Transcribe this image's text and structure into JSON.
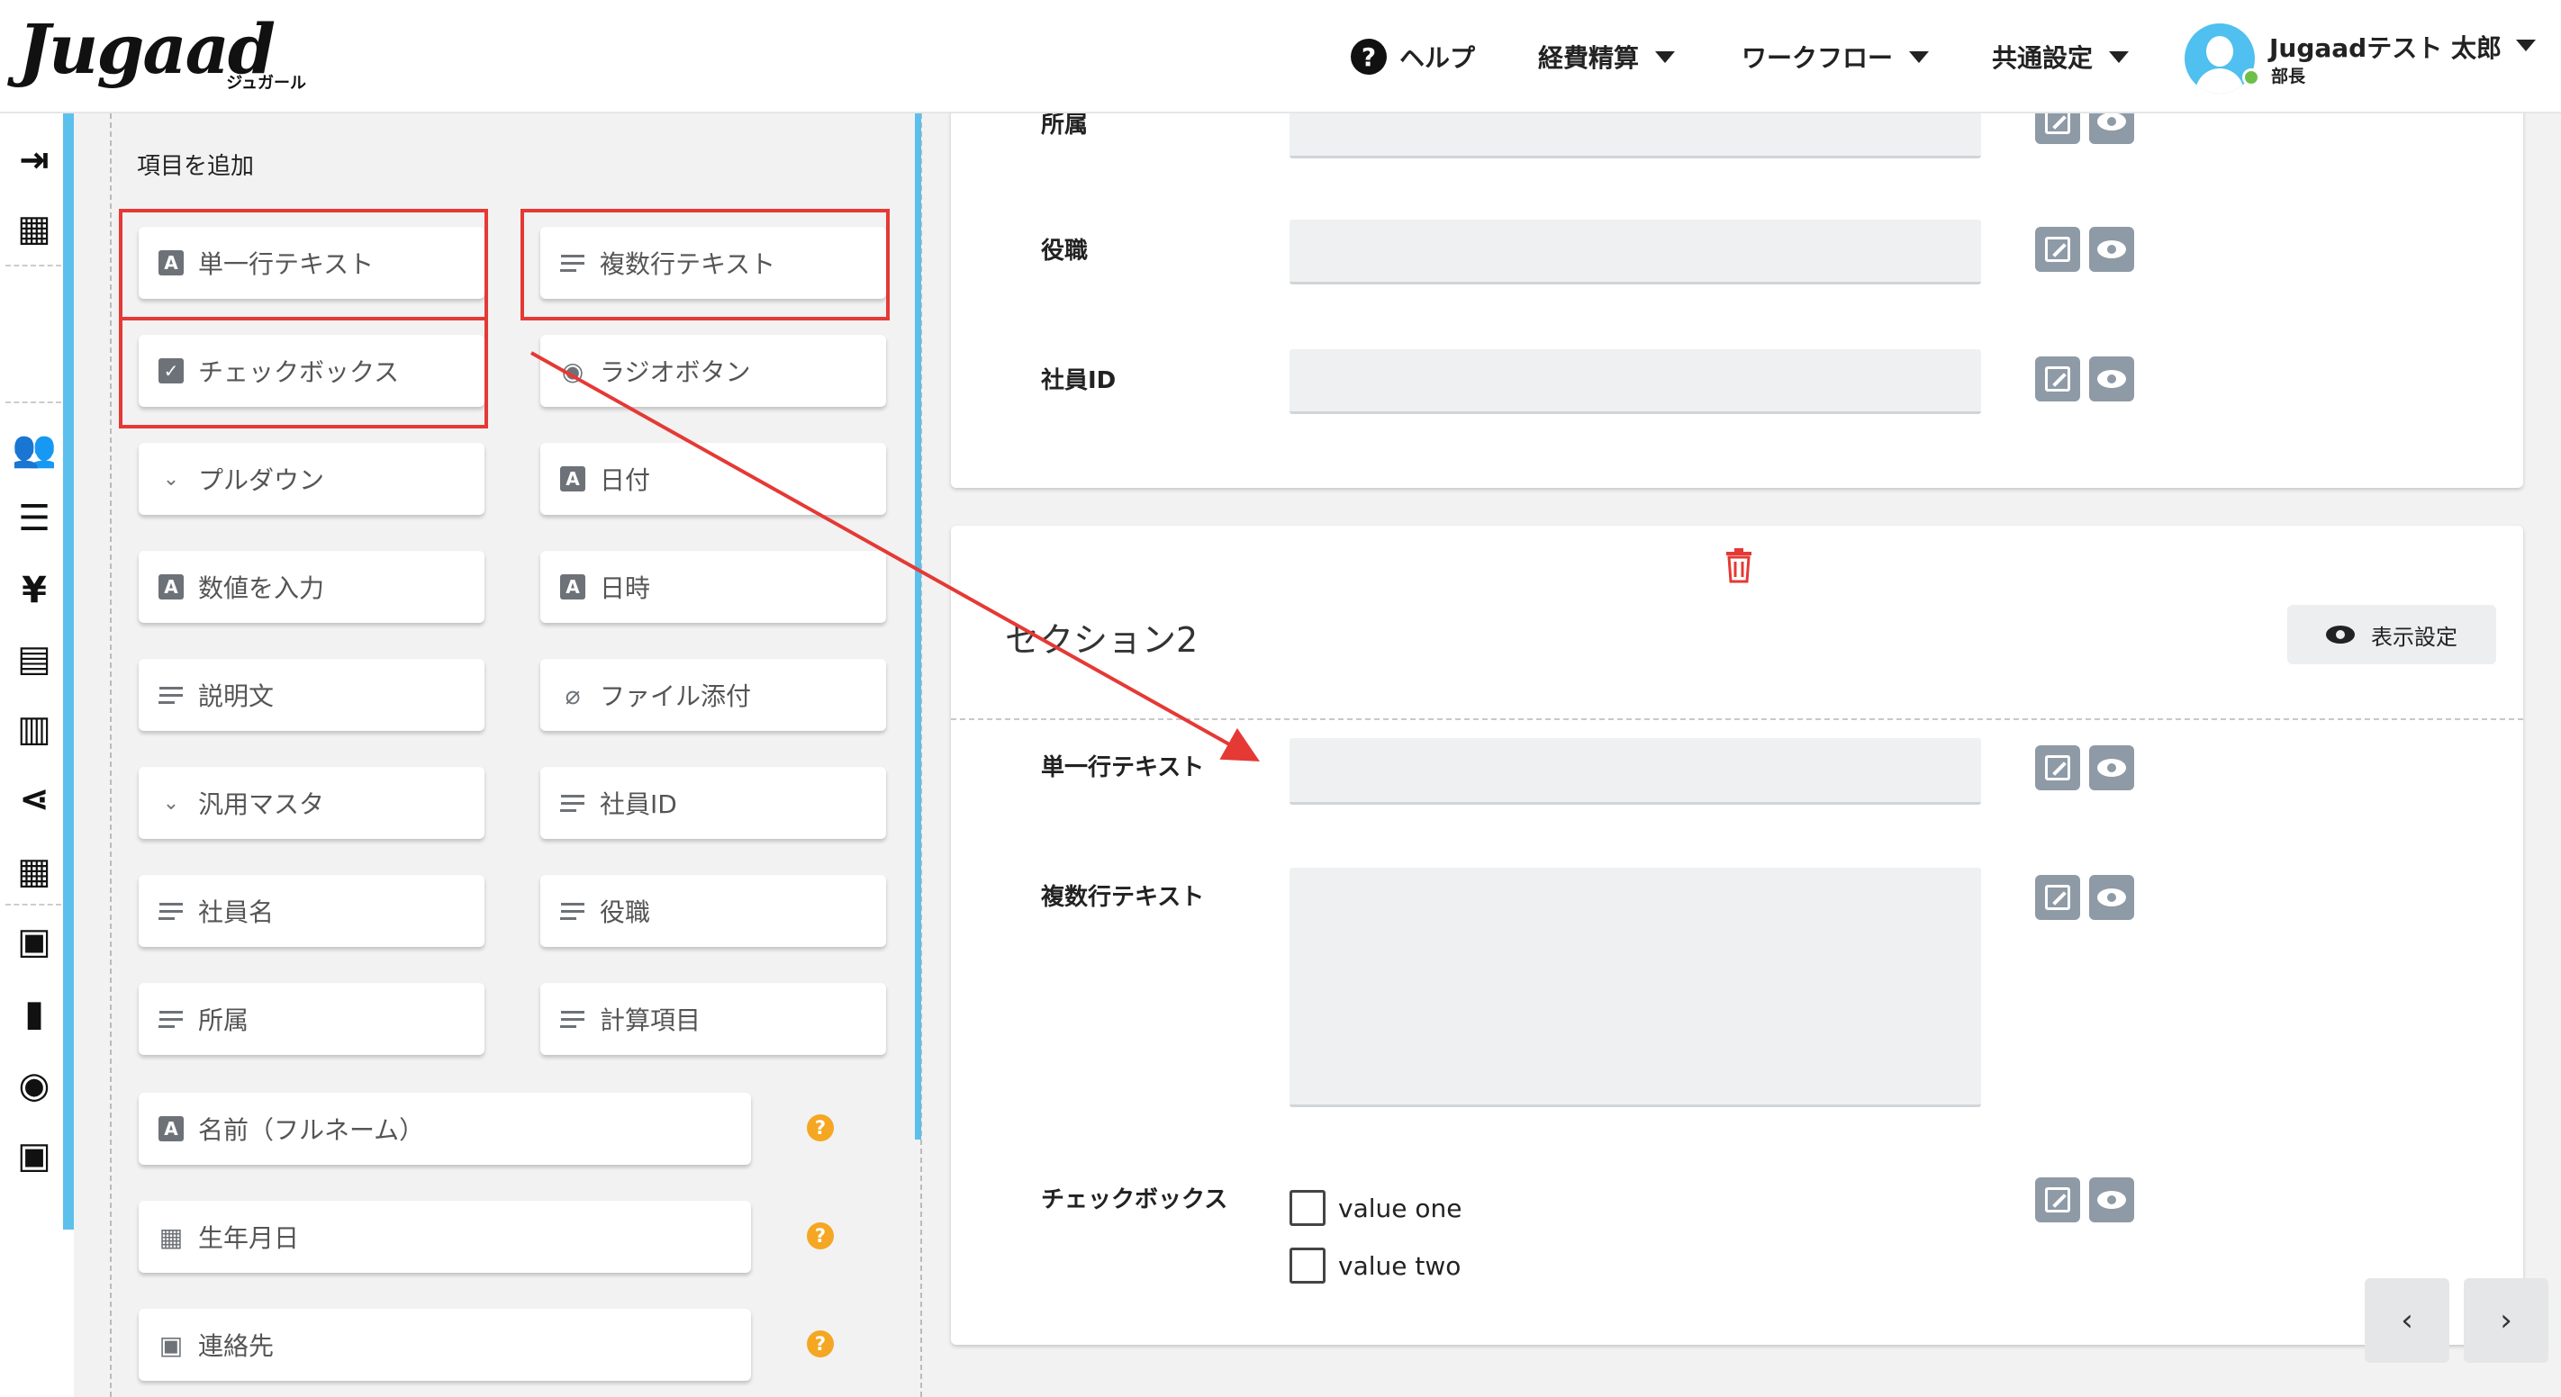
{
  "header": {
    "logo_text": "Jugaad",
    "logo_sub": "ジュガール",
    "nav": [
      {
        "label": "ヘルプ",
        "icon": "help-circle-icon"
      },
      {
        "label": "経費精算",
        "icon": "caret-down-icon"
      },
      {
        "label": "ワークフロー",
        "icon": "caret-down-icon"
      },
      {
        "label": "共通設定",
        "icon": "caret-down-icon"
      }
    ],
    "user": {
      "name": "Jugaadテスト 太郎",
      "role": "部長",
      "status_color": "#6cc04a"
    }
  },
  "rail": {
    "icons": [
      {
        "name": "collapse-menu-icon",
        "glyph": "⇥"
      },
      {
        "name": "building-icon",
        "glyph": "▦"
      },
      {
        "name": "users-icon",
        "glyph": "👥"
      },
      {
        "name": "list-icon",
        "glyph": "☰"
      },
      {
        "name": "yen-icon",
        "glyph": "¥"
      },
      {
        "name": "receipt-icon",
        "glyph": "▤"
      },
      {
        "name": "document-list-icon",
        "glyph": "▥"
      },
      {
        "name": "share-icon",
        "glyph": "⋖"
      },
      {
        "name": "grid-icon",
        "glyph": "▦"
      },
      {
        "name": "library-icon",
        "glyph": "▣"
      },
      {
        "name": "file-icon",
        "glyph": "▮"
      },
      {
        "name": "group-icon",
        "glyph": "◉"
      },
      {
        "name": "wallet-icon",
        "glyph": "▣"
      }
    ]
  },
  "palette": {
    "title": "項目を追加",
    "items": [
      {
        "label": "単一行テキスト",
        "icon": "text-a-icon",
        "highlighted": true
      },
      {
        "label": "複数行テキスト",
        "icon": "text-lines-icon",
        "highlighted": true
      },
      {
        "label": "チェックボックス",
        "icon": "checkbox-icon",
        "highlighted": true
      },
      {
        "label": "ラジオボタン",
        "icon": "radio-icon",
        "highlighted": false
      },
      {
        "label": "プルダウン",
        "icon": "chevron-down-icon",
        "highlighted": false
      },
      {
        "label": "日付",
        "icon": "text-a-icon",
        "highlighted": false
      },
      {
        "label": "数値を入力",
        "icon": "text-a-icon",
        "highlighted": false
      },
      {
        "label": "日時",
        "icon": "text-a-icon",
        "highlighted": false
      },
      {
        "label": "説明文",
        "icon": "text-lines-icon",
        "highlighted": false
      },
      {
        "label": "ファイル添付",
        "icon": "paperclip-icon",
        "highlighted": false
      },
      {
        "label": "汎用マスタ",
        "icon": "chevron-down-icon",
        "highlighted": false
      },
      {
        "label": "社員ID",
        "icon": "text-lines-icon",
        "highlighted": false
      },
      {
        "label": "社員名",
        "icon": "text-lines-icon",
        "highlighted": false
      },
      {
        "label": "役職",
        "icon": "text-lines-icon",
        "highlighted": false
      },
      {
        "label": "所属",
        "icon": "text-lines-icon",
        "highlighted": false
      },
      {
        "label": "計算項目",
        "icon": "text-lines-icon",
        "highlighted": false
      },
      {
        "label": "名前（フルネーム）",
        "icon": "text-a-icon",
        "highlighted": false
      },
      {
        "label": "生年月日",
        "icon": "calendar-icon",
        "highlighted": false
      },
      {
        "label": "連絡先",
        "icon": "contact-card-icon",
        "highlighted": false
      }
    ]
  },
  "section1": {
    "fields": [
      {
        "label": "所属"
      },
      {
        "label": "役職"
      },
      {
        "label": "社員ID"
      }
    ]
  },
  "section2": {
    "title": "セクション2",
    "display_settings_label": "表示設定",
    "fields": [
      {
        "label": "単一行テキスト"
      },
      {
        "label": "複数行テキスト"
      },
      {
        "label": "チェックボックス",
        "options": [
          "value one",
          "value two"
        ]
      }
    ]
  },
  "pagination": {
    "prev": "‹",
    "next": "›"
  },
  "colors": {
    "accent": "#5bc0eb",
    "highlight": "#e53935",
    "help_badge": "#f5a623"
  }
}
